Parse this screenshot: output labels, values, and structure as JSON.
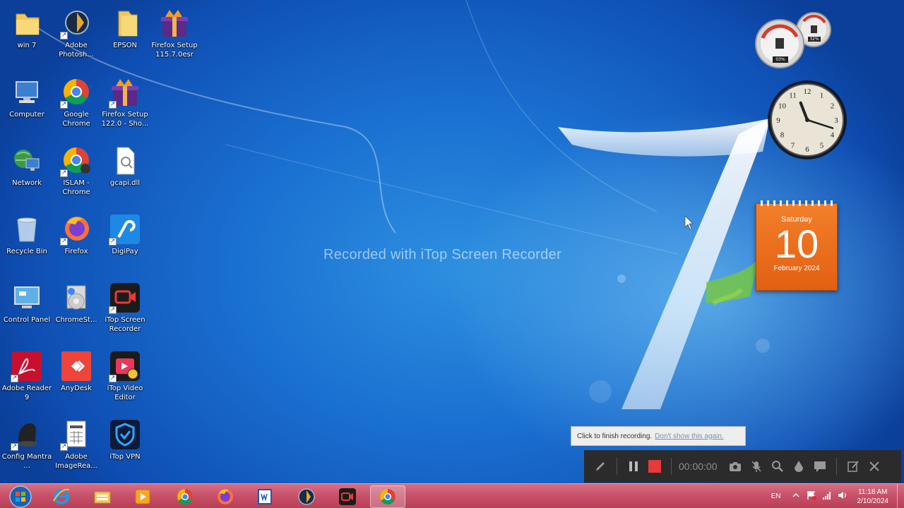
{
  "desktop_icons": [
    {
      "label": "win 7",
      "icon": "folder-icon"
    },
    {
      "label": "Adobe Photosh...",
      "icon": "photoshop-icon"
    },
    {
      "label": "EPSON",
      "icon": "folder-icon"
    },
    {
      "label": "Firefox Setup 115.7.0esr",
      "icon": "firefox-setup-icon"
    },
    {
      "label": "Computer",
      "icon": "computer-icon"
    },
    {
      "label": "Google Chrome",
      "icon": "chrome-icon"
    },
    {
      "label": "Firefox Setup 122.0 - Sho...",
      "icon": "firefox-setup-icon"
    },
    {
      "label": "Network",
      "icon": "network-icon"
    },
    {
      "label": "ISLAM - Chrome",
      "icon": "chrome-icon"
    },
    {
      "label": "gcapi.dll",
      "icon": "dll-file-icon"
    },
    {
      "label": "Recycle Bin",
      "icon": "recycle-bin-icon"
    },
    {
      "label": "Firefox",
      "icon": "firefox-icon"
    },
    {
      "label": "DigiPay",
      "icon": "digipay-icon"
    },
    {
      "label": "Control Panel",
      "icon": "control-panel-icon"
    },
    {
      "label": "ChromeSt...",
      "icon": "chromesetup-icon"
    },
    {
      "label": "iTop Screen Recorder",
      "icon": "itop-recorder-icon"
    },
    {
      "label": "Adobe Reader 9",
      "icon": "adobe-reader-icon"
    },
    {
      "label": "AnyDesk",
      "icon": "anydesk-icon"
    },
    {
      "label": "iTop Video Editor",
      "icon": "itop-video-editor-icon"
    },
    {
      "label": "Config Mantra ...",
      "icon": "mantra-scanner-icon"
    },
    {
      "label": "Adobe ImageRea...",
      "icon": "image-reader-icon"
    },
    {
      "label": "iTop VPN",
      "icon": "itop-vpn-icon"
    }
  ],
  "watermark": "Recorded with iTop Screen Recorder",
  "cpu_gadget": {
    "cpu_percent": "03%",
    "memory_percent": "32%"
  },
  "clock_gadget": {
    "hour": 11,
    "minute": 18
  },
  "calendar": {
    "weekday": "Saturday",
    "day": "10",
    "month_year": "February 2024"
  },
  "recorder": {
    "tooltip_text": "Click to finish recording.",
    "tooltip_link": "Don't show this again.",
    "timer": "00:00:00"
  },
  "taskbar": {
    "pinned": [
      "internet-explorer-icon",
      "file-explorer-icon",
      "media-player-icon",
      "chrome-icon",
      "firefox-icon",
      "word-document-icon",
      "media-center-icon",
      "itop-recorder-icon",
      "chrome-icon"
    ],
    "active_index": 8,
    "language": "EN",
    "time": "11:18 AM",
    "date": "2/10/2024"
  },
  "colors": {
    "accent_orange": "#e8671a",
    "taskbar": "#c75067",
    "record_red": "#e83a3a"
  }
}
